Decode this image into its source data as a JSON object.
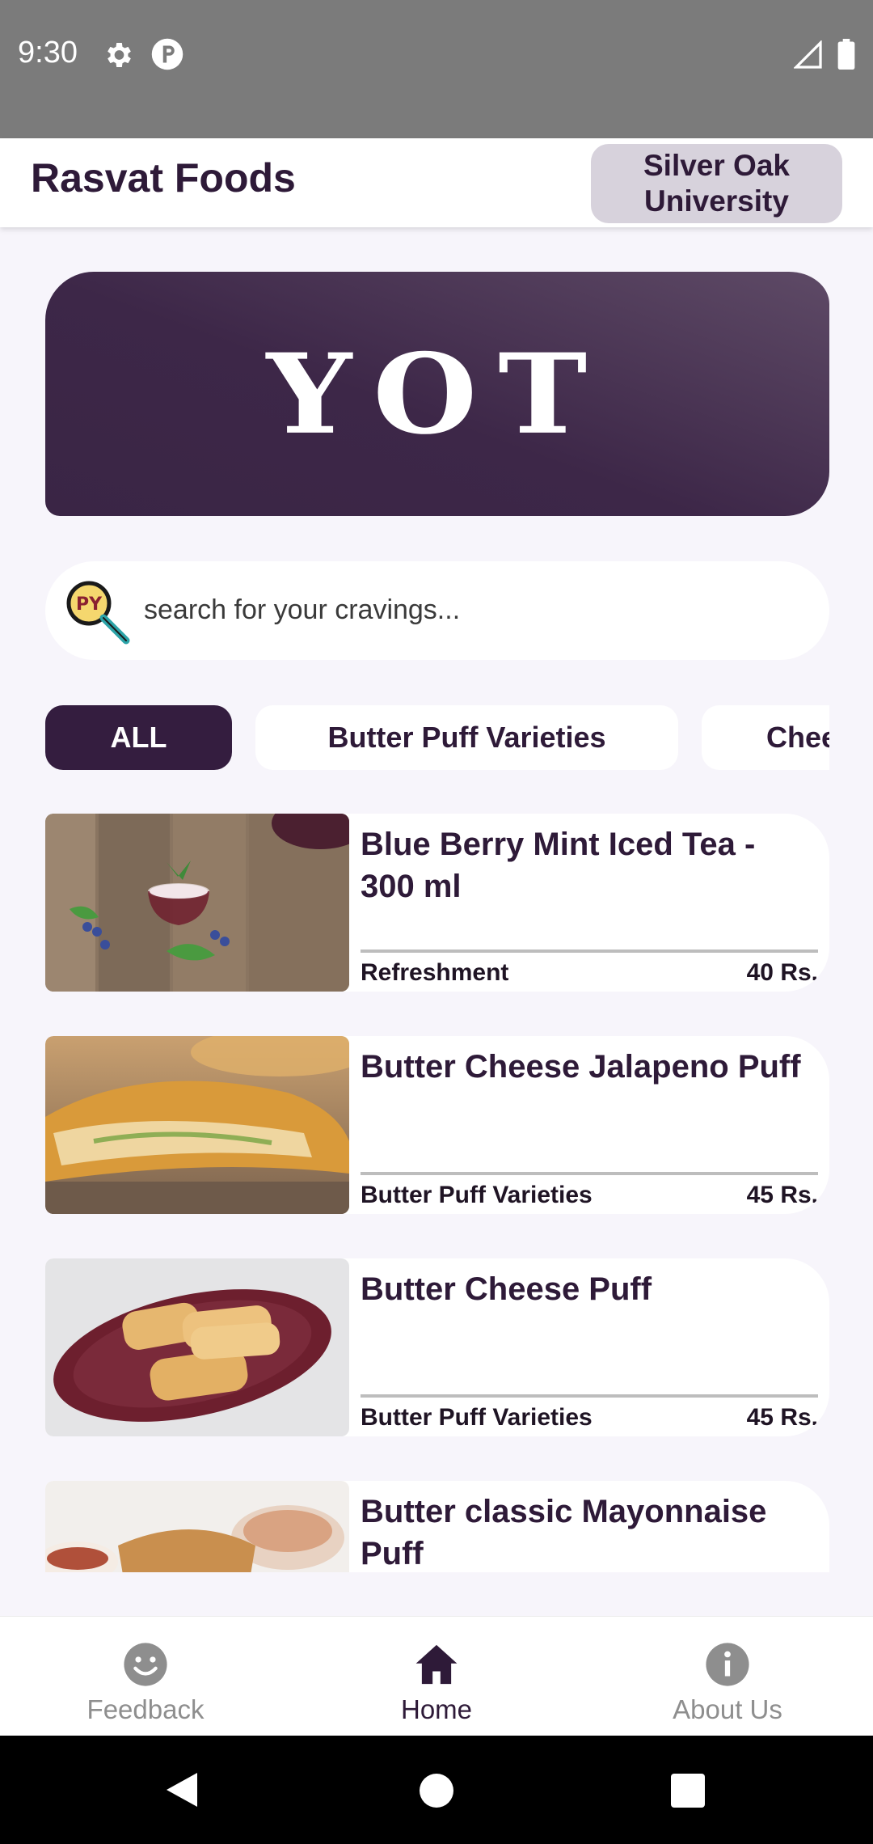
{
  "status_bar": {
    "time": "9:30",
    "icons": [
      "gear-icon",
      "p-circle-icon",
      "signal-icon",
      "battery-icon"
    ]
  },
  "app_bar": {
    "title": "Rasvat Foods",
    "campus": "Silver Oak University"
  },
  "banner": {
    "text": "YOT"
  },
  "search": {
    "placeholder": "search for your cravings..."
  },
  "categories": {
    "active": "ALL",
    "items": [
      "ALL",
      "Butter Puff Varieties",
      "Cheese"
    ]
  },
  "menu_items": [
    {
      "name": "Blue Berry Mint Iced Tea - 300 ml",
      "category": "Refreshment",
      "price": "40 Rs."
    },
    {
      "name": "Butter Cheese Jalapeno Puff",
      "category": "Butter Puff Varieties",
      "price": "45 Rs."
    },
    {
      "name": "Butter Cheese Puff",
      "category": "Butter Puff Varieties",
      "price": "45 Rs."
    },
    {
      "name": "Butter classic Mayonnaise Puff",
      "category": "",
      "price": ""
    }
  ],
  "bottom_nav": {
    "items": [
      {
        "label": "Feedback",
        "icon": "smiley-icon"
      },
      {
        "label": "Home",
        "icon": "home-icon"
      },
      {
        "label": "About Us",
        "icon": "info-icon"
      }
    ],
    "active": "Home"
  },
  "colors": {
    "brand": "#341d3f",
    "banner": "#3d2748",
    "status_bar": "#7b7b7b"
  }
}
